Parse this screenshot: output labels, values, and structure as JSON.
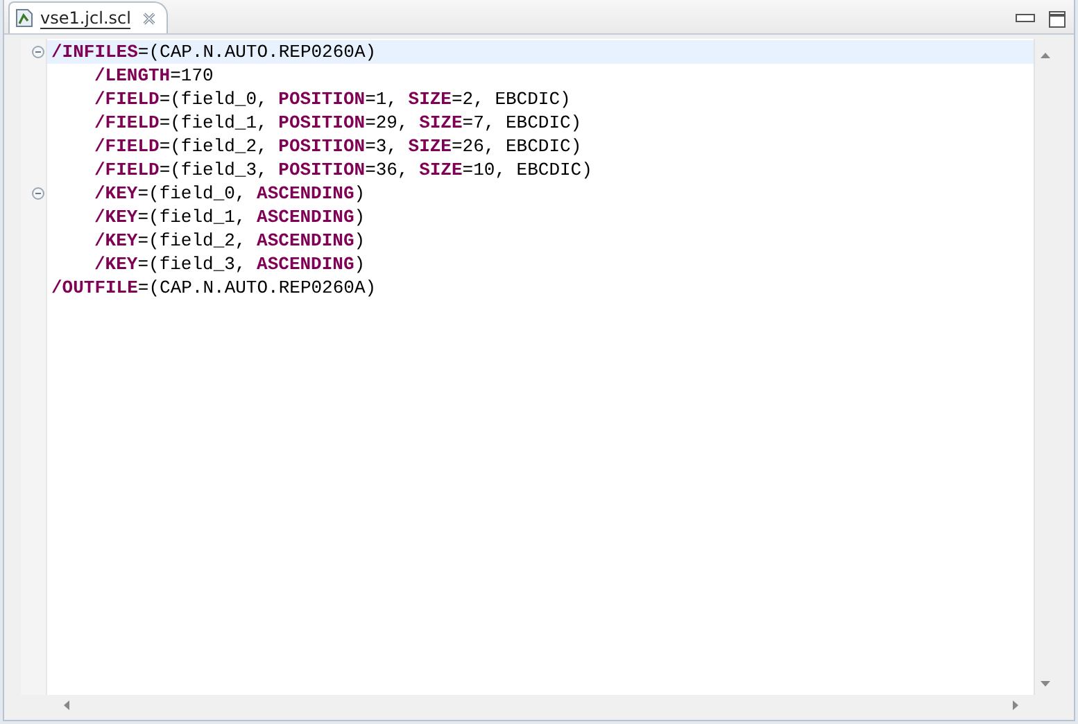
{
  "tabs": [
    {
      "label": "vse1.jcl.scl",
      "selected": true
    }
  ],
  "editor": {
    "lines": [
      {
        "indented": false,
        "fold_marker": true,
        "current": true,
        "tokens": [
          {
            "kind": "keyword",
            "text": "/INFILES"
          },
          {
            "kind": "plain",
            "text": "=(CAP.N.AUTO.REP0260A)"
          }
        ]
      },
      {
        "indented": true,
        "fold_marker": false,
        "current": false,
        "tokens": [
          {
            "kind": "keyword",
            "text": "/LENGTH"
          },
          {
            "kind": "plain",
            "text": "=170"
          }
        ]
      },
      {
        "indented": true,
        "fold_marker": false,
        "current": false,
        "tokens": [
          {
            "kind": "keyword",
            "text": "/FIELD"
          },
          {
            "kind": "plain",
            "text": "=(field_0, "
          },
          {
            "kind": "keyword",
            "text": "POSITION"
          },
          {
            "kind": "plain",
            "text": "=1, "
          },
          {
            "kind": "keyword",
            "text": "SIZE"
          },
          {
            "kind": "plain",
            "text": "=2, EBCDIC)"
          }
        ]
      },
      {
        "indented": true,
        "fold_marker": false,
        "current": false,
        "tokens": [
          {
            "kind": "keyword",
            "text": "/FIELD"
          },
          {
            "kind": "plain",
            "text": "=(field_1, "
          },
          {
            "kind": "keyword",
            "text": "POSITION"
          },
          {
            "kind": "plain",
            "text": "=29, "
          },
          {
            "kind": "keyword",
            "text": "SIZE"
          },
          {
            "kind": "plain",
            "text": "=7, EBCDIC)"
          }
        ]
      },
      {
        "indented": true,
        "fold_marker": false,
        "current": false,
        "tokens": [
          {
            "kind": "keyword",
            "text": "/FIELD"
          },
          {
            "kind": "plain",
            "text": "=(field_2, "
          },
          {
            "kind": "keyword",
            "text": "POSITION"
          },
          {
            "kind": "plain",
            "text": "=3, "
          },
          {
            "kind": "keyword",
            "text": "SIZE"
          },
          {
            "kind": "plain",
            "text": "=26, EBCDIC)"
          }
        ]
      },
      {
        "indented": true,
        "fold_marker": false,
        "current": false,
        "tokens": [
          {
            "kind": "keyword",
            "text": "/FIELD"
          },
          {
            "kind": "plain",
            "text": "=(field_3, "
          },
          {
            "kind": "keyword",
            "text": "POSITION"
          },
          {
            "kind": "plain",
            "text": "=36, "
          },
          {
            "kind": "keyword",
            "text": "SIZE"
          },
          {
            "kind": "plain",
            "text": "=10, EBCDIC)"
          }
        ]
      },
      {
        "indented": true,
        "fold_marker": true,
        "current": false,
        "tokens": [
          {
            "kind": "keyword",
            "text": "/KEY"
          },
          {
            "kind": "plain",
            "text": "=(field_0, "
          },
          {
            "kind": "keyword",
            "text": "ASCENDING"
          },
          {
            "kind": "plain",
            "text": ")"
          }
        ]
      },
      {
        "indented": true,
        "fold_marker": false,
        "current": false,
        "tokens": [
          {
            "kind": "keyword",
            "text": "/KEY"
          },
          {
            "kind": "plain",
            "text": "=(field_1, "
          },
          {
            "kind": "keyword",
            "text": "ASCENDING"
          },
          {
            "kind": "plain",
            "text": ")"
          }
        ]
      },
      {
        "indented": true,
        "fold_marker": false,
        "current": false,
        "tokens": [
          {
            "kind": "keyword",
            "text": "/KEY"
          },
          {
            "kind": "plain",
            "text": "=(field_2, "
          },
          {
            "kind": "keyword",
            "text": "ASCENDING"
          },
          {
            "kind": "plain",
            "text": ")"
          }
        ]
      },
      {
        "indented": true,
        "fold_marker": false,
        "current": false,
        "tokens": [
          {
            "kind": "keyword",
            "text": "/KEY"
          },
          {
            "kind": "plain",
            "text": "=(field_3, "
          },
          {
            "kind": "keyword",
            "text": "ASCENDING"
          },
          {
            "kind": "plain",
            "text": ")"
          }
        ]
      },
      {
        "indented": false,
        "fold_marker": false,
        "current": false,
        "tokens": [
          {
            "kind": "keyword",
            "text": "/OUTFILE"
          },
          {
            "kind": "plain",
            "text": "=(CAP.N.AUTO.REP0260A)"
          }
        ]
      }
    ]
  }
}
